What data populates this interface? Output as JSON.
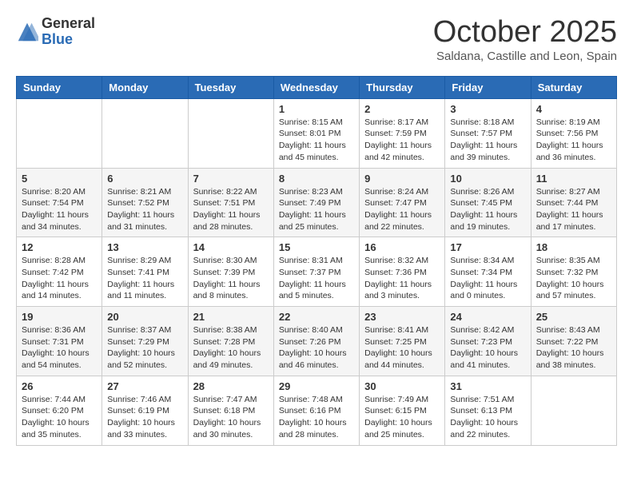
{
  "header": {
    "logo_general": "General",
    "logo_blue": "Blue",
    "month_title": "October 2025",
    "location": "Saldana, Castille and Leon, Spain"
  },
  "weekdays": [
    "Sunday",
    "Monday",
    "Tuesday",
    "Wednesday",
    "Thursday",
    "Friday",
    "Saturday"
  ],
  "weeks": [
    [
      {
        "day": "",
        "info": ""
      },
      {
        "day": "",
        "info": ""
      },
      {
        "day": "",
        "info": ""
      },
      {
        "day": "1",
        "info": "Sunrise: 8:15 AM\nSunset: 8:01 PM\nDaylight: 11 hours and 45 minutes."
      },
      {
        "day": "2",
        "info": "Sunrise: 8:17 AM\nSunset: 7:59 PM\nDaylight: 11 hours and 42 minutes."
      },
      {
        "day": "3",
        "info": "Sunrise: 8:18 AM\nSunset: 7:57 PM\nDaylight: 11 hours and 39 minutes."
      },
      {
        "day": "4",
        "info": "Sunrise: 8:19 AM\nSunset: 7:56 PM\nDaylight: 11 hours and 36 minutes."
      }
    ],
    [
      {
        "day": "5",
        "info": "Sunrise: 8:20 AM\nSunset: 7:54 PM\nDaylight: 11 hours and 34 minutes."
      },
      {
        "day": "6",
        "info": "Sunrise: 8:21 AM\nSunset: 7:52 PM\nDaylight: 11 hours and 31 minutes."
      },
      {
        "day": "7",
        "info": "Sunrise: 8:22 AM\nSunset: 7:51 PM\nDaylight: 11 hours and 28 minutes."
      },
      {
        "day": "8",
        "info": "Sunrise: 8:23 AM\nSunset: 7:49 PM\nDaylight: 11 hours and 25 minutes."
      },
      {
        "day": "9",
        "info": "Sunrise: 8:24 AM\nSunset: 7:47 PM\nDaylight: 11 hours and 22 minutes."
      },
      {
        "day": "10",
        "info": "Sunrise: 8:26 AM\nSunset: 7:45 PM\nDaylight: 11 hours and 19 minutes."
      },
      {
        "day": "11",
        "info": "Sunrise: 8:27 AM\nSunset: 7:44 PM\nDaylight: 11 hours and 17 minutes."
      }
    ],
    [
      {
        "day": "12",
        "info": "Sunrise: 8:28 AM\nSunset: 7:42 PM\nDaylight: 11 hours and 14 minutes."
      },
      {
        "day": "13",
        "info": "Sunrise: 8:29 AM\nSunset: 7:41 PM\nDaylight: 11 hours and 11 minutes."
      },
      {
        "day": "14",
        "info": "Sunrise: 8:30 AM\nSunset: 7:39 PM\nDaylight: 11 hours and 8 minutes."
      },
      {
        "day": "15",
        "info": "Sunrise: 8:31 AM\nSunset: 7:37 PM\nDaylight: 11 hours and 5 minutes."
      },
      {
        "day": "16",
        "info": "Sunrise: 8:32 AM\nSunset: 7:36 PM\nDaylight: 11 hours and 3 minutes."
      },
      {
        "day": "17",
        "info": "Sunrise: 8:34 AM\nSunset: 7:34 PM\nDaylight: 11 hours and 0 minutes."
      },
      {
        "day": "18",
        "info": "Sunrise: 8:35 AM\nSunset: 7:32 PM\nDaylight: 10 hours and 57 minutes."
      }
    ],
    [
      {
        "day": "19",
        "info": "Sunrise: 8:36 AM\nSunset: 7:31 PM\nDaylight: 10 hours and 54 minutes."
      },
      {
        "day": "20",
        "info": "Sunrise: 8:37 AM\nSunset: 7:29 PM\nDaylight: 10 hours and 52 minutes."
      },
      {
        "day": "21",
        "info": "Sunrise: 8:38 AM\nSunset: 7:28 PM\nDaylight: 10 hours and 49 minutes."
      },
      {
        "day": "22",
        "info": "Sunrise: 8:40 AM\nSunset: 7:26 PM\nDaylight: 10 hours and 46 minutes."
      },
      {
        "day": "23",
        "info": "Sunrise: 8:41 AM\nSunset: 7:25 PM\nDaylight: 10 hours and 44 minutes."
      },
      {
        "day": "24",
        "info": "Sunrise: 8:42 AM\nSunset: 7:23 PM\nDaylight: 10 hours and 41 minutes."
      },
      {
        "day": "25",
        "info": "Sunrise: 8:43 AM\nSunset: 7:22 PM\nDaylight: 10 hours and 38 minutes."
      }
    ],
    [
      {
        "day": "26",
        "info": "Sunrise: 7:44 AM\nSunset: 6:20 PM\nDaylight: 10 hours and 35 minutes."
      },
      {
        "day": "27",
        "info": "Sunrise: 7:46 AM\nSunset: 6:19 PM\nDaylight: 10 hours and 33 minutes."
      },
      {
        "day": "28",
        "info": "Sunrise: 7:47 AM\nSunset: 6:18 PM\nDaylight: 10 hours and 30 minutes."
      },
      {
        "day": "29",
        "info": "Sunrise: 7:48 AM\nSunset: 6:16 PM\nDaylight: 10 hours and 28 minutes."
      },
      {
        "day": "30",
        "info": "Sunrise: 7:49 AM\nSunset: 6:15 PM\nDaylight: 10 hours and 25 minutes."
      },
      {
        "day": "31",
        "info": "Sunrise: 7:51 AM\nSunset: 6:13 PM\nDaylight: 10 hours and 22 minutes."
      },
      {
        "day": "",
        "info": ""
      }
    ]
  ]
}
